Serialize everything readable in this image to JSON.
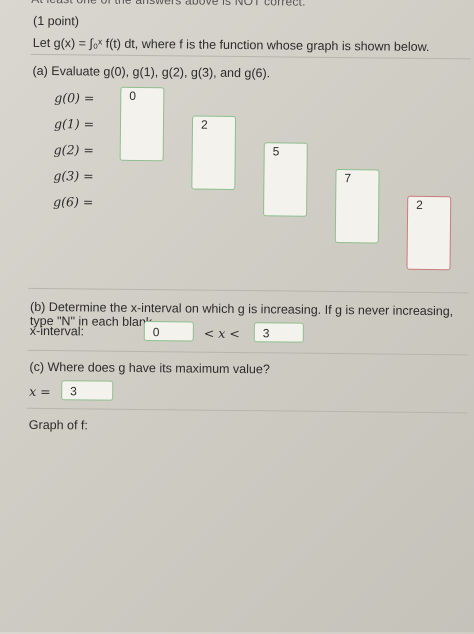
{
  "notice": "At least one of the answers above is NOT correct.",
  "problem": {
    "points": "(1 point)",
    "definition": "Let g(x) = ∫₀ˣ f(t) dt, where f is the function whose graph is shown below."
  },
  "part_a": {
    "prompt": "(a) Evaluate g(0), g(1), g(2), g(3), and g(6).",
    "items": [
      {
        "label": "g(0) =",
        "value": "0"
      },
      {
        "label": "g(1) =",
        "value": "2"
      },
      {
        "label": "g(2) =",
        "value": "5"
      },
      {
        "label": "g(3) =",
        "value": "7"
      },
      {
        "label": "g(6) =",
        "value": "2"
      }
    ]
  },
  "part_b": {
    "prompt": "(b) Determine the x-interval on which g is increasing. If g is never increasing, type \"N\" in each blank.",
    "interval_label": "x-interval:",
    "lower": "0",
    "middle": "< x <",
    "upper": "3"
  },
  "part_c": {
    "prompt": "(c) Where does g have its maximum value?",
    "label": "x =",
    "value": "3"
  },
  "graph_caption": "Graph of f:"
}
